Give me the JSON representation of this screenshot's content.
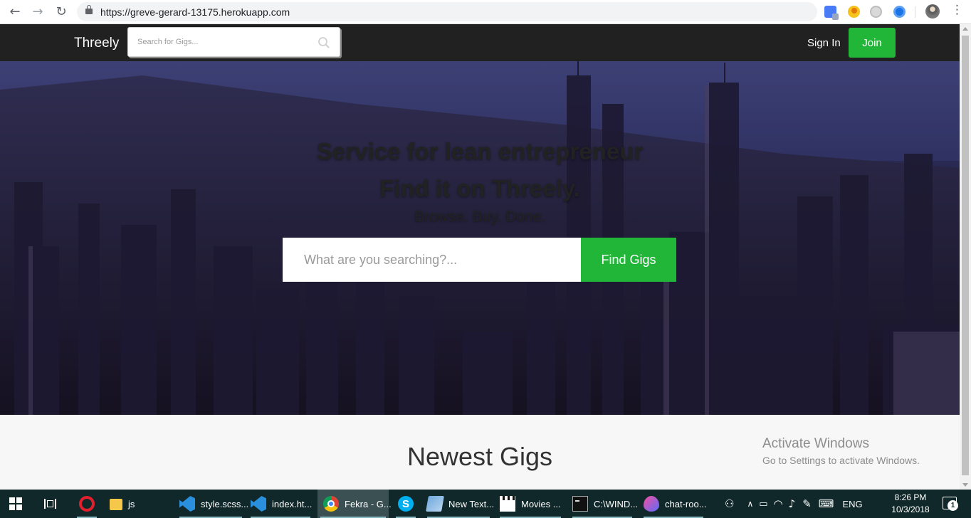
{
  "browser": {
    "url": "https://greve-gerard-13175.herokuapp.com",
    "back_glyph": "←",
    "forward_glyph": "→",
    "reload_glyph": "↻",
    "bookmark_glyph": "☆",
    "menu_glyph": "⋮"
  },
  "site_nav": {
    "brand": "Threely",
    "search_placeholder": "Search for Gigs...",
    "sign_in": "Sign In",
    "join": "Join"
  },
  "hero": {
    "line1": "Service for lean entrepreneur",
    "line2": "Find it on Threely.",
    "subtitle": "Browse. Buy. Done.",
    "search_placeholder": "What are you searching?...",
    "button": "Find Gigs"
  },
  "section": {
    "title": "Newest Gigs"
  },
  "watermark": {
    "title": "Activate Windows",
    "subtitle": "Go to Settings to activate Windows."
  },
  "taskbar": {
    "items": [
      {
        "label": ""
      },
      {
        "label": "js"
      },
      {
        "label": "style.scss..."
      },
      {
        "label": "index.ht..."
      },
      {
        "label": "Fekra - G..."
      },
      {
        "label": ""
      },
      {
        "label": "New Text..."
      },
      {
        "label": "Movies ..."
      },
      {
        "label": "C:\\WIND..."
      },
      {
        "label": "chat-roo..."
      }
    ],
    "language": "ENG",
    "time": "8:26 PM",
    "date": "10/3/2018",
    "notification_count": "1"
  },
  "colors": {
    "nav_bg": "#212121",
    "accent_green": "#21b638",
    "taskbar_bg": "#10282a",
    "hero_tint": "#36386f"
  },
  "icons": [
    "back-arrow-icon",
    "forward-arrow-icon",
    "reload-icon",
    "lock-icon",
    "star-icon",
    "search-icon",
    "windows-start-icon",
    "task-view-icon",
    "opera-icon",
    "folder-icon",
    "vscode-icon",
    "chrome-icon",
    "skype-icon",
    "notepad-icon",
    "clapperboard-icon",
    "cmd-icon",
    "balloon-icon",
    "people-icon",
    "network-icon",
    "volume-icon",
    "pen-icon",
    "keyboard-icon",
    "notification-icon"
  ]
}
